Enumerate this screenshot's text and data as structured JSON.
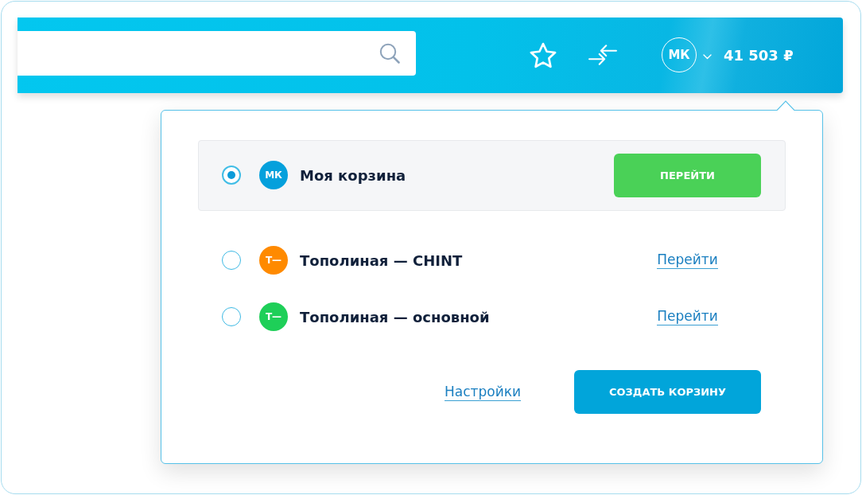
{
  "header": {
    "user_initials": "МК",
    "balance": "41 503 ₽"
  },
  "cart_menu": {
    "carts": [
      {
        "initials": "МК",
        "name": "Моя корзина",
        "color": "#04a0dc",
        "selected": true,
        "action": "ПЕРЕЙТИ"
      },
      {
        "initials": "Т—",
        "name": "Тополиная — CHINT",
        "color": "#ff8a00",
        "selected": false,
        "action": "Перейти"
      },
      {
        "initials": "Т—",
        "name": "Тополиная — основной",
        "color": "#1ecf58",
        "selected": false,
        "action": "Перейти"
      }
    ],
    "settings_link": "Настройки",
    "create_button": "СОЗДАТЬ КОРЗИНУ"
  }
}
